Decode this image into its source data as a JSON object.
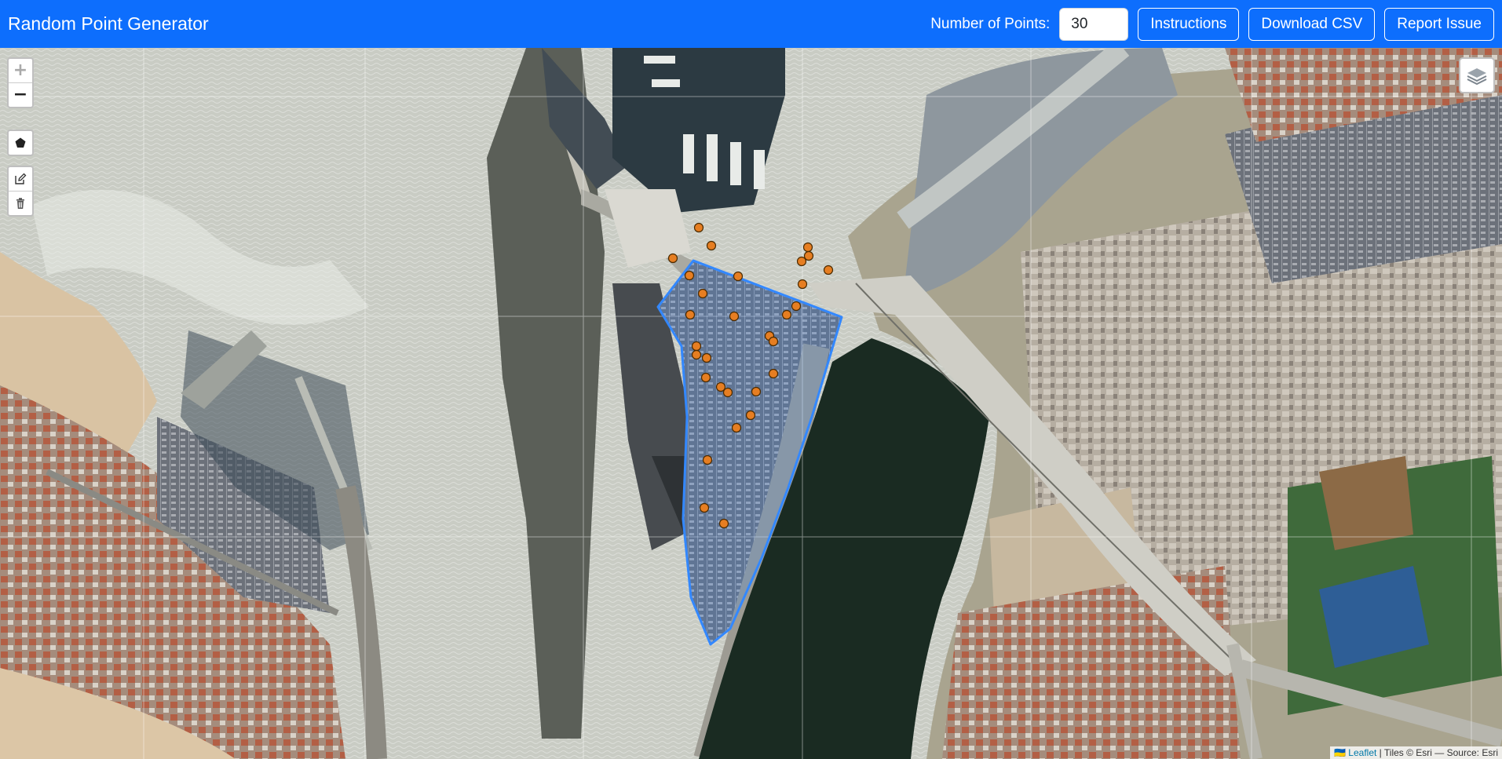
{
  "app": {
    "title": "Random Point Generator"
  },
  "header": {
    "num_points_label": "Number of Points:",
    "num_points_value": "30",
    "buttons": {
      "instructions": "Instructions",
      "download_csv": "Download CSV",
      "report_issue": "Report Issue"
    }
  },
  "map": {
    "zoom_in_glyph": "+",
    "zoom_out_glyph": "−",
    "tools": [
      "pentagon-draw-icon",
      "edit-icon",
      "trash-icon"
    ],
    "layers_icon": "layers-icon",
    "attribution": {
      "flag": "🇺🇦",
      "leaflet_link": "Leaflet",
      "rest": " | Tiles © Esri — Source: Esri"
    },
    "colors": {
      "polygon_stroke": "#3388ff",
      "point_fill": "#e67e22",
      "point_stroke": "#4a2a00",
      "header_bg": "#0d6efd"
    }
  }
}
